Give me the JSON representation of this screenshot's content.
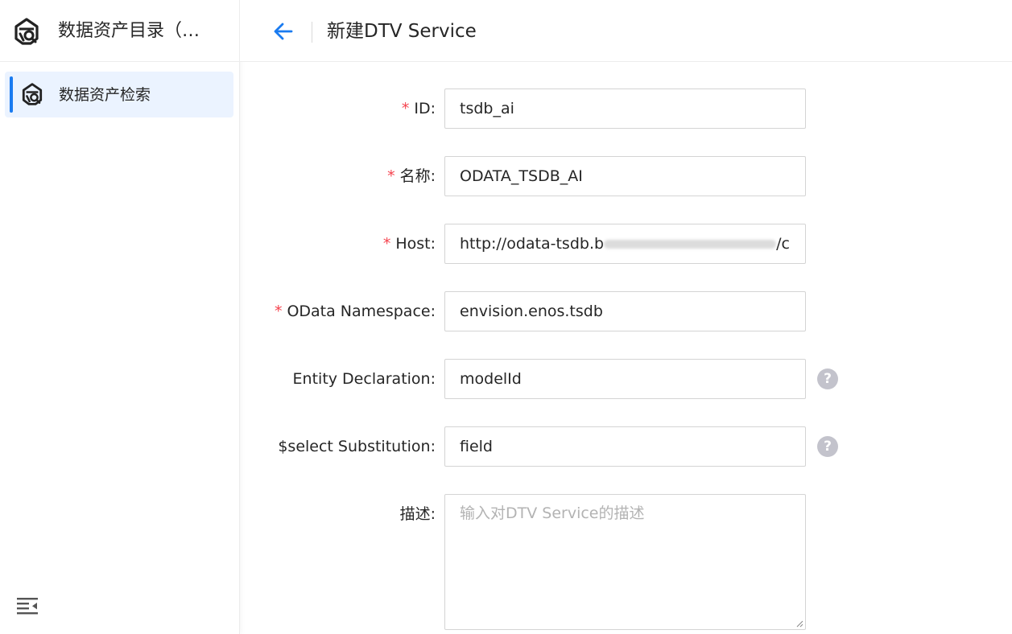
{
  "sidebar": {
    "app_title": "数据资产目录（…",
    "items": [
      {
        "label": "数据资产检索",
        "icon": "logo-icon",
        "active": true
      }
    ],
    "collapse_icon": "menu-collapse-icon"
  },
  "header": {
    "back_icon": "arrow-left-icon",
    "title": "新建DTV Service"
  },
  "form": {
    "fields": [
      {
        "label": "ID:",
        "required": true,
        "value": "tsdb_ai"
      },
      {
        "label": "名称:",
        "required": true,
        "value": "ODATA_TSDB_AI"
      },
      {
        "label": "Host:",
        "required": true,
        "value_prefix": "http://odata-tsdb.b",
        "value_suffix": "/c"
      },
      {
        "label": "OData Namespace:",
        "required": true,
        "value": "envision.enos.tsdb"
      },
      {
        "label": "Entity Declaration:",
        "required": false,
        "value": "modelId",
        "help": true
      },
      {
        "label": "$select Substitution:",
        "required": false,
        "value": "field",
        "help": true
      },
      {
        "label": "描述:",
        "required": false,
        "value": "",
        "placeholder": "输入对DTV Service的描述"
      }
    ],
    "required_mark": "*",
    "help_glyph": "?"
  },
  "colors": {
    "accent": "#1a7bf0",
    "active_bg": "#ebf3ff",
    "required": "#f5434e",
    "help_icon": "#c3c3cc",
    "border": "#d4d4d4"
  }
}
